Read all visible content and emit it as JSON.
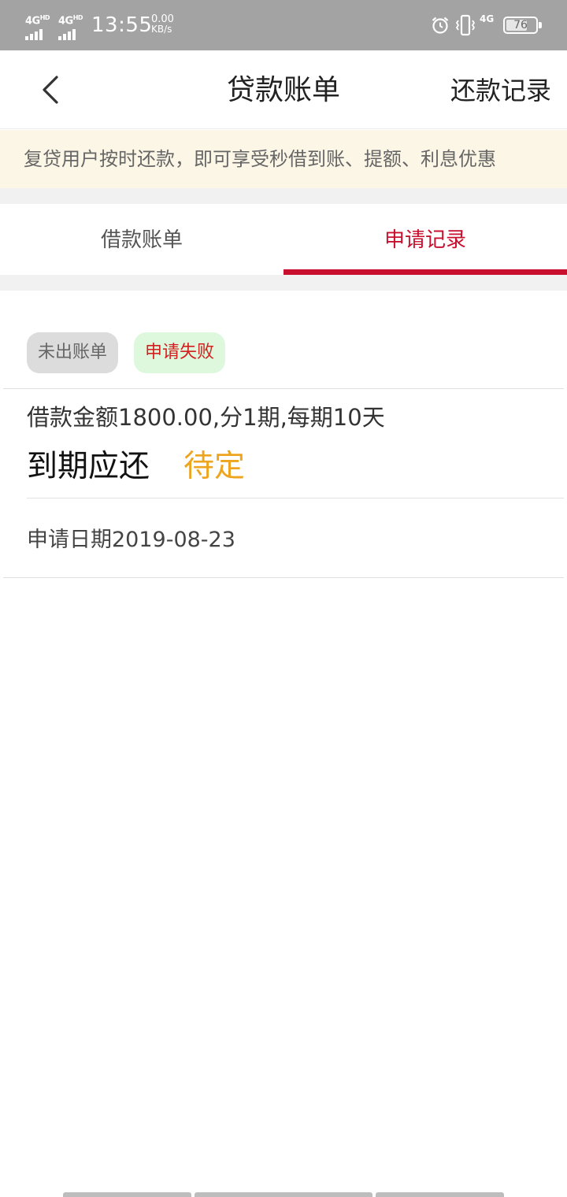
{
  "status_bar": {
    "network_1": "4G",
    "network_1_sup": "HD",
    "network_2": "4G",
    "network_2_sup": "HD",
    "time": "13:55",
    "speed_value": "0.00",
    "speed_unit": "KB/s",
    "network_3": "4G",
    "battery": "76",
    "icons": [
      "alarm-icon",
      "vibrate-icon",
      "signal-icon",
      "battery-icon"
    ]
  },
  "nav": {
    "back_icon": "chevron-left-icon",
    "title": "贷款账单",
    "right_link": "还款记录"
  },
  "notice": {
    "text": "复贷用户按时还款，即可享受秒借到账、提额、利息优惠"
  },
  "tabs": [
    {
      "label": "借款账单",
      "active": false
    },
    {
      "label": "申请记录",
      "active": true
    }
  ],
  "record": {
    "badges": [
      "未出账单",
      "申请失败"
    ],
    "loan_desc": "借款金额1800.00,分1期,每期10天",
    "due_label": "到期应还",
    "due_value": "待定",
    "apply_date": "申请日期2019-08-23"
  },
  "colors": {
    "accent": "#c8102e",
    "pending": "#eda520",
    "notice_bg": "#fcf6e6",
    "status_bar_bg": "#a3a3a3"
  }
}
